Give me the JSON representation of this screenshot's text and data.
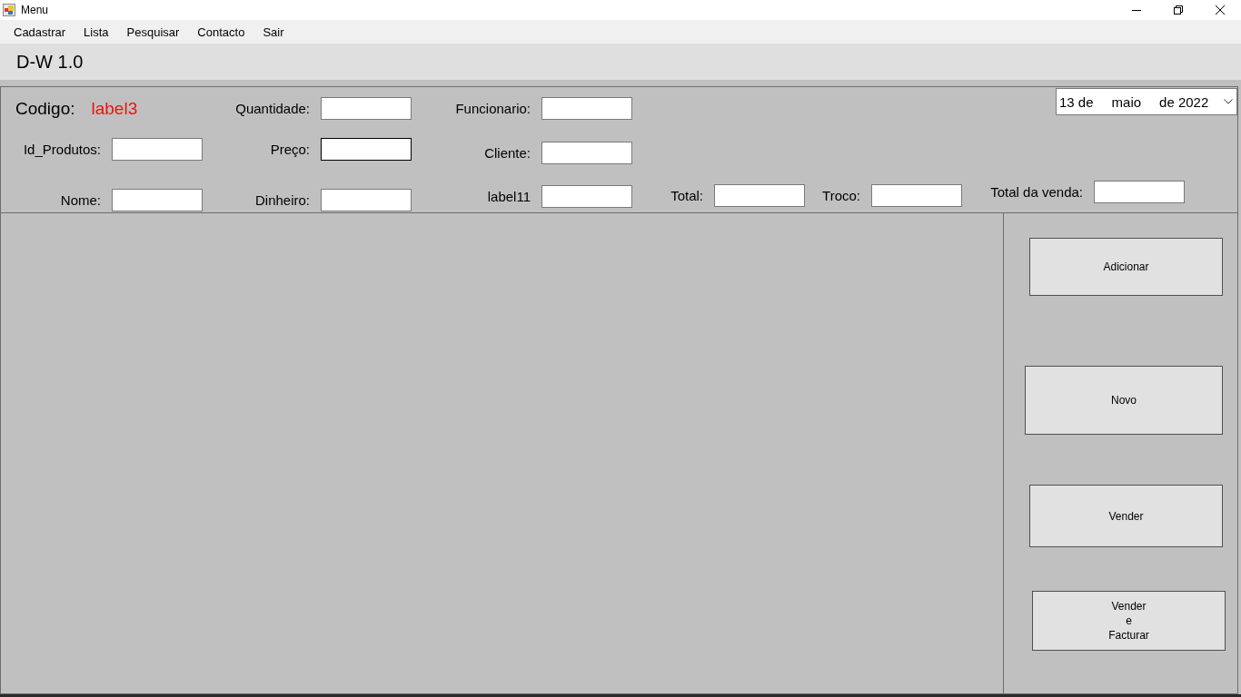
{
  "window": {
    "title": "Menu"
  },
  "menu_bar": {
    "items": [
      "Cadastrar",
      "Lista",
      "Pesquisar",
      "Contacto",
      "Sair"
    ]
  },
  "header": {
    "title": "D-W 1.0"
  },
  "form": {
    "code": {
      "label": "Codigo:",
      "value": "label3"
    },
    "date_picker": {
      "parts": [
        "13 de",
        "maio",
        "de 2022"
      ]
    },
    "fields": [
      {
        "label": "Quantidade:",
        "focused": false
      },
      {
        "label": "Funcionario:",
        "focused": false
      },
      {
        "label": "Id_Produtos:",
        "focused": false
      },
      {
        "label": "Preço:",
        "focused": true
      },
      {
        "label": "Cliente:",
        "focused": false
      },
      {
        "label": "Nome:",
        "focused": false
      },
      {
        "label": "Dinheiro:",
        "focused": false
      },
      {
        "label": "label11",
        "focused": false
      },
      {
        "label": "Total:",
        "focused": false
      },
      {
        "label": "Troco:",
        "focused": false
      },
      {
        "label": "Total da venda:",
        "focused": false
      }
    ]
  },
  "buttons": [
    {
      "label": "Adicionar"
    },
    {
      "label": "Novo"
    },
    {
      "label": "Vender"
    },
    {
      "label": "Vender\ne\nFacturar"
    }
  ]
}
